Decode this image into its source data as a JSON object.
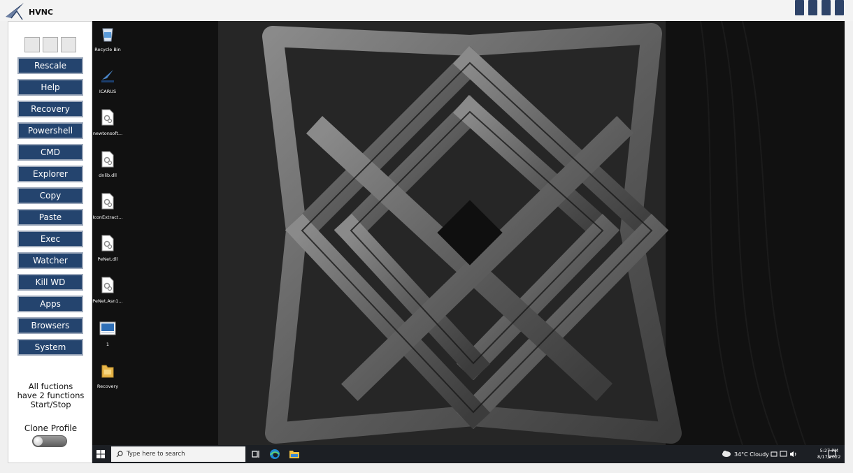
{
  "window": {
    "title": "HVNC",
    "accent_color": "#2e4368"
  },
  "sidebar": {
    "buttons": [
      {
        "label": "Rescale"
      },
      {
        "label": "Help"
      },
      {
        "label": "Recovery"
      },
      {
        "label": "Powershell"
      },
      {
        "label": "CMD"
      },
      {
        "label": "Explorer"
      },
      {
        "label": "Copy"
      },
      {
        "label": "Paste"
      },
      {
        "label": "Exec"
      },
      {
        "label": "Watcher"
      },
      {
        "label": "Kill WD"
      },
      {
        "label": "Apps"
      },
      {
        "label": "Browsers"
      },
      {
        "label": "System"
      }
    ],
    "button_color": "#24446e",
    "note": {
      "line1": "All fuctions",
      "line2": "have 2 functions",
      "line3": "Start/Stop"
    },
    "clone_profile_label": "Clone Profile",
    "clone_profile_on": false
  },
  "desktop": {
    "icons": [
      {
        "label": "Recycle Bin",
        "icon": "recycle-bin-icon"
      },
      {
        "label": "ICARUS",
        "icon": "icarus-logo-icon"
      },
      {
        "label": "newtonsoft...",
        "icon": "dll-file-icon"
      },
      {
        "label": "dnlib.dll",
        "icon": "dll-file-icon"
      },
      {
        "label": "IconExtract...",
        "icon": "dll-file-icon"
      },
      {
        "label": "PeNet.dll",
        "icon": "dll-file-icon"
      },
      {
        "label": "PeNet.Asn1...",
        "icon": "dll-file-icon"
      },
      {
        "label": "1",
        "icon": "screenshot-file-icon"
      },
      {
        "label": "Recovery",
        "icon": "folder-icon"
      }
    ]
  },
  "taskbar": {
    "search_placeholder": "Type here to search",
    "weather": "34°C  Cloudy",
    "time": "5:27 PM",
    "date": "8/17/2022"
  }
}
